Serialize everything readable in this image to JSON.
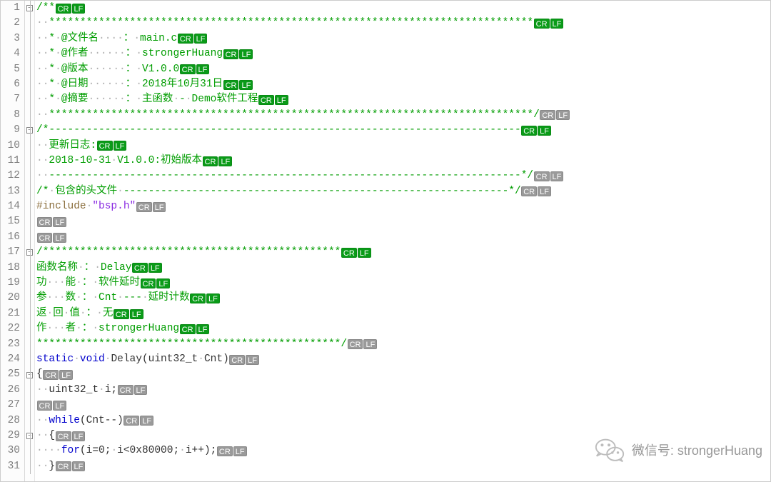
{
  "editor": {
    "line_numbers": [
      "1",
      "2",
      "3",
      "4",
      "5",
      "6",
      "7",
      "8",
      "9",
      "10",
      "11",
      "12",
      "13",
      "14",
      "15",
      "16",
      "17",
      "18",
      "19",
      "20",
      "21",
      "22",
      "23",
      "24",
      "25",
      "26",
      "27",
      "28",
      "29",
      "30",
      "31"
    ],
    "fold": {
      "boxes_at": [
        1,
        9,
        17,
        25,
        29
      ],
      "line_start_at": 1,
      "line_end_at": 31
    },
    "tags": {
      "cr": "CR",
      "lf": "LF"
    },
    "lines": [
      {
        "tokens": [
          {
            "cls": "comment",
            "text": "/**"
          }
        ],
        "eol": "g"
      },
      {
        "tokens": [
          {
            "cls": "dotchar",
            "text": "··"
          },
          {
            "cls": "comment",
            "text": "******************************************************************************"
          }
        ],
        "eol": "g"
      },
      {
        "tokens": [
          {
            "cls": "dotchar",
            "text": "··"
          },
          {
            "cls": "comment",
            "text": "*"
          },
          {
            "cls": "dotchar",
            "text": "·"
          },
          {
            "cls": "comment",
            "text": "@文件名"
          },
          {
            "cls": "dotchar",
            "text": "····"
          },
          {
            "cls": "comment",
            "text": "："
          },
          {
            "cls": "dotchar",
            "text": "·"
          },
          {
            "cls": "comment",
            "text": "main.c"
          }
        ],
        "eol": "g"
      },
      {
        "tokens": [
          {
            "cls": "dotchar",
            "text": "··"
          },
          {
            "cls": "comment",
            "text": "*"
          },
          {
            "cls": "dotchar",
            "text": "·"
          },
          {
            "cls": "comment",
            "text": "@作者"
          },
          {
            "cls": "dotchar",
            "text": "······"
          },
          {
            "cls": "comment",
            "text": "："
          },
          {
            "cls": "dotchar",
            "text": "·"
          },
          {
            "cls": "comment",
            "text": "strongerHuang"
          }
        ],
        "eol": "g"
      },
      {
        "tokens": [
          {
            "cls": "dotchar",
            "text": "··"
          },
          {
            "cls": "comment",
            "text": "*"
          },
          {
            "cls": "dotchar",
            "text": "·"
          },
          {
            "cls": "comment",
            "text": "@版本"
          },
          {
            "cls": "dotchar",
            "text": "······"
          },
          {
            "cls": "comment",
            "text": "："
          },
          {
            "cls": "dotchar",
            "text": "·"
          },
          {
            "cls": "comment",
            "text": "V1.0.0"
          }
        ],
        "eol": "g"
      },
      {
        "tokens": [
          {
            "cls": "dotchar",
            "text": "··"
          },
          {
            "cls": "comment",
            "text": "*"
          },
          {
            "cls": "dotchar",
            "text": "·"
          },
          {
            "cls": "comment",
            "text": "@日期"
          },
          {
            "cls": "dotchar",
            "text": "······"
          },
          {
            "cls": "comment",
            "text": "："
          },
          {
            "cls": "dotchar",
            "text": "·"
          },
          {
            "cls": "comment",
            "text": "2018年10月31日"
          }
        ],
        "eol": "g"
      },
      {
        "tokens": [
          {
            "cls": "dotchar",
            "text": "··"
          },
          {
            "cls": "comment",
            "text": "*"
          },
          {
            "cls": "dotchar",
            "text": "·"
          },
          {
            "cls": "comment",
            "text": "@摘要"
          },
          {
            "cls": "dotchar",
            "text": "······"
          },
          {
            "cls": "comment",
            "text": "："
          },
          {
            "cls": "dotchar",
            "text": "·"
          },
          {
            "cls": "comment",
            "text": "主函数"
          },
          {
            "cls": "dotchar",
            "text": "·"
          },
          {
            "cls": "comment",
            "text": "-"
          },
          {
            "cls": "dotchar",
            "text": "·"
          },
          {
            "cls": "comment",
            "text": "Demo软件工程"
          }
        ],
        "eol": "g"
      },
      {
        "tokens": [
          {
            "cls": "dotchar",
            "text": "··"
          },
          {
            "cls": "comment",
            "text": "******************************************************************************/"
          }
        ],
        "eol": "grey"
      },
      {
        "tokens": [
          {
            "cls": "comment",
            "text": "/*----------------------------------------------------------------------------"
          }
        ],
        "eol": "g"
      },
      {
        "tokens": [
          {
            "cls": "dotchar",
            "text": "··"
          },
          {
            "cls": "comment",
            "text": "更新日志:"
          }
        ],
        "eol": "g"
      },
      {
        "tokens": [
          {
            "cls": "dotchar",
            "text": "··"
          },
          {
            "cls": "comment",
            "text": "2018-10-31"
          },
          {
            "cls": "dotchar",
            "text": "·"
          },
          {
            "cls": "comment",
            "text": "V1.0.0:初始版本"
          }
        ],
        "eol": "g"
      },
      {
        "tokens": [
          {
            "cls": "dotchar",
            "text": "··"
          },
          {
            "cls": "comment",
            "text": "----------------------------------------------------------------------------*/"
          }
        ],
        "eol": "grey"
      },
      {
        "tokens": [
          {
            "cls": "comment",
            "text": "/*"
          },
          {
            "cls": "dotchar",
            "text": "·"
          },
          {
            "cls": "comment",
            "text": "包含的头文件"
          },
          {
            "cls": "dotchar",
            "text": "·"
          },
          {
            "cls": "comment",
            "text": "--------------------------------------------------------------*/"
          }
        ],
        "eol": "grey"
      },
      {
        "tokens": [
          {
            "cls": "preproc",
            "text": "#include"
          },
          {
            "cls": "dotchar",
            "text": "·"
          },
          {
            "cls": "string",
            "text": "\"bsp.h\""
          }
        ],
        "eol": "grey"
      },
      {
        "tokens": [],
        "eol": "grey"
      },
      {
        "tokens": [],
        "eol": "grey"
      },
      {
        "tokens": [
          {
            "cls": "comment",
            "text": "/************************************************"
          }
        ],
        "eol": "g"
      },
      {
        "tokens": [
          {
            "cls": "comment",
            "text": "函数名称"
          },
          {
            "cls": "dotchar",
            "text": "·"
          },
          {
            "cls": "comment",
            "text": "："
          },
          {
            "cls": "dotchar",
            "text": "·"
          },
          {
            "cls": "comment",
            "text": "Delay"
          }
        ],
        "eol": "g"
      },
      {
        "tokens": [
          {
            "cls": "comment",
            "text": "功"
          },
          {
            "cls": "dotchar",
            "text": "···"
          },
          {
            "cls": "comment",
            "text": "能"
          },
          {
            "cls": "dotchar",
            "text": "·"
          },
          {
            "cls": "comment",
            "text": "："
          },
          {
            "cls": "dotchar",
            "text": "·"
          },
          {
            "cls": "comment",
            "text": "软件延时"
          }
        ],
        "eol": "g"
      },
      {
        "tokens": [
          {
            "cls": "comment",
            "text": "参"
          },
          {
            "cls": "dotchar",
            "text": "···"
          },
          {
            "cls": "comment",
            "text": "数"
          },
          {
            "cls": "dotchar",
            "text": "·"
          },
          {
            "cls": "comment",
            "text": "："
          },
          {
            "cls": "dotchar",
            "text": "·"
          },
          {
            "cls": "comment",
            "text": "Cnt"
          },
          {
            "cls": "dotchar",
            "text": "·"
          },
          {
            "cls": "comment",
            "text": "---"
          },
          {
            "cls": "dotchar",
            "text": "·"
          },
          {
            "cls": "comment",
            "text": "延时计数"
          }
        ],
        "eol": "g"
      },
      {
        "tokens": [
          {
            "cls": "comment",
            "text": "返"
          },
          {
            "cls": "dotchar",
            "text": "·"
          },
          {
            "cls": "comment",
            "text": "回"
          },
          {
            "cls": "dotchar",
            "text": "·"
          },
          {
            "cls": "comment",
            "text": "值"
          },
          {
            "cls": "dotchar",
            "text": "·"
          },
          {
            "cls": "comment",
            "text": "："
          },
          {
            "cls": "dotchar",
            "text": "·"
          },
          {
            "cls": "comment",
            "text": "无"
          }
        ],
        "eol": "g"
      },
      {
        "tokens": [
          {
            "cls": "comment",
            "text": "作"
          },
          {
            "cls": "dotchar",
            "text": "···"
          },
          {
            "cls": "comment",
            "text": "者"
          },
          {
            "cls": "dotchar",
            "text": "·"
          },
          {
            "cls": "comment",
            "text": "："
          },
          {
            "cls": "dotchar",
            "text": "·"
          },
          {
            "cls": "comment",
            "text": "strongerHuang"
          }
        ],
        "eol": "g"
      },
      {
        "tokens": [
          {
            "cls": "comment",
            "text": "*************************************************/"
          }
        ],
        "eol": "grey"
      },
      {
        "tokens": [
          {
            "cls": "keyword",
            "text": "static"
          },
          {
            "cls": "dotchar",
            "text": "·"
          },
          {
            "cls": "keyword",
            "text": "void"
          },
          {
            "cls": "dotchar",
            "text": "·"
          },
          {
            "cls": "plain",
            "text": "Delay(uint32_t"
          },
          {
            "cls": "dotchar",
            "text": "·"
          },
          {
            "cls": "plain",
            "text": "Cnt)"
          }
        ],
        "eol": "grey"
      },
      {
        "tokens": [
          {
            "cls": "plain",
            "text": "{"
          }
        ],
        "eol": "grey"
      },
      {
        "tokens": [
          {
            "cls": "dotchar",
            "text": "··"
          },
          {
            "cls": "plain",
            "text": "uint32_t"
          },
          {
            "cls": "dotchar",
            "text": "·"
          },
          {
            "cls": "plain",
            "text": "i;"
          }
        ],
        "eol": "grey"
      },
      {
        "tokens": [],
        "eol": "grey"
      },
      {
        "tokens": [
          {
            "cls": "dotchar",
            "text": "··"
          },
          {
            "cls": "keyword",
            "text": "while"
          },
          {
            "cls": "plain",
            "text": "(Cnt--)"
          }
        ],
        "eol": "grey"
      },
      {
        "tokens": [
          {
            "cls": "dotchar",
            "text": "··"
          },
          {
            "cls": "plain",
            "text": "{"
          }
        ],
        "eol": "grey"
      },
      {
        "tokens": [
          {
            "cls": "dotchar",
            "text": "····"
          },
          {
            "cls": "keyword",
            "text": "for"
          },
          {
            "cls": "plain",
            "text": "(i=0;"
          },
          {
            "cls": "dotchar",
            "text": "·"
          },
          {
            "cls": "plain",
            "text": "i<0x80000;"
          },
          {
            "cls": "dotchar",
            "text": "·"
          },
          {
            "cls": "plain",
            "text": "i++);"
          }
        ],
        "eol": "grey"
      },
      {
        "tokens": [
          {
            "cls": "dotchar",
            "text": "··"
          },
          {
            "cls": "plain",
            "text": "}"
          }
        ],
        "eol": "grey"
      }
    ]
  },
  "watermark": {
    "label": "微信号",
    "sep": ": ",
    "value": "strongerHuang"
  }
}
